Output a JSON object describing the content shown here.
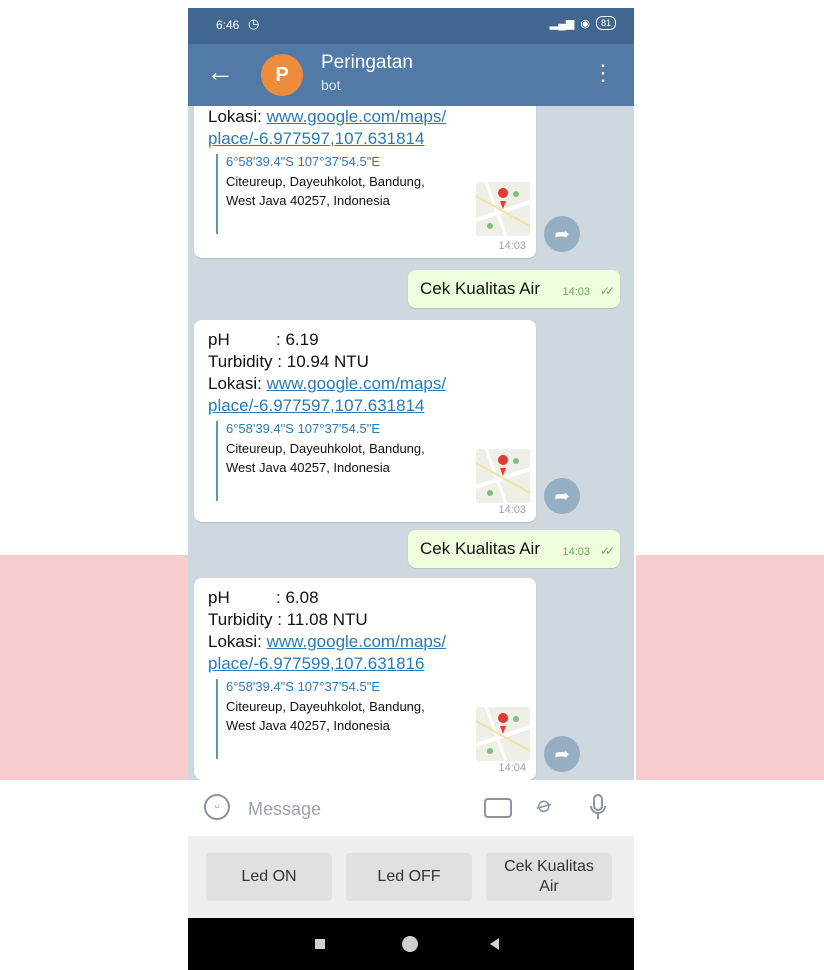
{
  "status": {
    "time": "6:46",
    "battery": "81"
  },
  "header": {
    "avatar_letter": "P",
    "title": "Peringatan",
    "subtitle": "bot"
  },
  "messages": [
    {
      "location_label": "Lokasi: ",
      "link_line1": "www.google.com/maps/",
      "link_line2": "place/-6.977597,107.631814",
      "preview_title": "6°58'39.4\"S 107°37'54.5\"E",
      "preview_addr1": "Citeureup, Dayeuhkolot, Bandung,",
      "preview_addr2": "West Java 40257, Indonesia",
      "time": "14:03"
    },
    {
      "text": "Cek Kualitas Air",
      "time": "14:03"
    },
    {
      "ph_label": "pH",
      "ph_value": ": 6.19",
      "turb_label": "Turbidity",
      "turb_value": ": 10.94 NTU",
      "location_label": "Lokasi: ",
      "link_line1": "www.google.com/maps/",
      "link_line2": "place/-6.977597,107.631814",
      "preview_title": "6°58'39.4\"S 107°37'54.5\"E",
      "preview_addr1": "Citeureup, Dayeuhkolot, Bandung,",
      "preview_addr2": "West Java 40257, Indonesia",
      "time": "14:03"
    },
    {
      "text": "Cek Kualitas Air",
      "time": "14:03"
    },
    {
      "ph_label": "pH",
      "ph_value": ": 6.08",
      "turb_label": "Turbidity",
      "turb_value": ": 11.08 NTU",
      "location_label": "Lokasi: ",
      "link_line1": "www.google.com/maps/",
      "link_line2": "place/-6.977599,107.631816",
      "preview_title": "6°58'39.4\"S 107°37'54.5\"E",
      "preview_addr1": "Citeureup, Dayeuhkolot, Bandung,",
      "preview_addr2": "West Java 40257, Indonesia",
      "time": "14:04"
    }
  ],
  "composer": {
    "placeholder": "Message"
  },
  "keyboard_buttons": [
    "Led ON",
    "Led OFF",
    "Cek Kualitas\nAir"
  ],
  "colors": {
    "header": "#517ba6",
    "status_bar": "#41668f",
    "avatar": "#ef8c3b",
    "outgoing_bubble": "#effedd",
    "link": "#2b7ab6",
    "chat_bg": "#cfd8df"
  },
  "icons": [
    "back-arrow-icon",
    "more-vert-icon",
    "alarm-icon",
    "signal-icon",
    "wifi-icon",
    "battery-icon",
    "share-icon",
    "emoji-icon",
    "keyboard-icon",
    "attach-icon",
    "mic-icon",
    "read-checks-icon",
    "map-pin-icon"
  ]
}
